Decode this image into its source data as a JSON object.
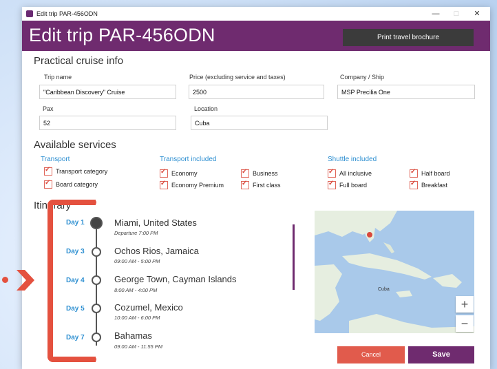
{
  "window": {
    "title": "Edit trip PAR-456ODN",
    "controls": {
      "minimize": "—",
      "maximize": "□",
      "close": "✕"
    }
  },
  "header": {
    "title": "Edit trip PAR-456ODN",
    "print_button": "Print travel brochure"
  },
  "practical": {
    "section_title": "Practical cruise info",
    "trip_name_label": "Trip name",
    "trip_name_value": "\"Caribbean Discovery\" Cruise",
    "price_label": "Price (excluding service and taxes)",
    "price_value": "2500",
    "company_label": "Company / Ship",
    "company_value": "MSP Precilia One",
    "pax_label": "Pax",
    "pax_value": "52",
    "location_label": "Location",
    "location_value": "Cuba"
  },
  "services": {
    "section_title": "Available services",
    "transport": {
      "label": "Transport",
      "items": [
        "Transport category",
        "Board category"
      ]
    },
    "transport_included": {
      "label": "Transport included",
      "items": [
        "Economy",
        "Economy Premium",
        "Business",
        "First class"
      ]
    },
    "shuttle_included": {
      "label": "Shuttle included",
      "items": [
        "All inclusive",
        "Full board",
        "Half board",
        "Breakfast"
      ]
    }
  },
  "itinerary": {
    "section_title": "Itinerary",
    "stops": [
      {
        "day": "Day 1",
        "place": "Miami, United States",
        "time": "Departure 7:00 PM"
      },
      {
        "day": "Day 3",
        "place": "Ochos Rios, Jamaica",
        "time": "09:00 AM - 5:00 PM"
      },
      {
        "day": "Day 4",
        "place": "George Town, Cayman Islands",
        "time": "8:00 AM - 4:00 PM"
      },
      {
        "day": "Day 5",
        "place": "Cozumel, Mexico",
        "time": "10:00 AM - 6:00 PM"
      },
      {
        "day": "Day 7",
        "place": "Bahamas",
        "time": "09:00 AM - 11:55 PM"
      }
    ]
  },
  "map": {
    "labels": [
      "Cuba"
    ],
    "zoom_in": "+",
    "zoom_out": "−"
  },
  "actions": {
    "cancel": "Cancel",
    "save": "Save"
  },
  "colors": {
    "brand": "#6f2b6f",
    "accent": "#2d8fd1",
    "highlight": "#e4513f"
  }
}
